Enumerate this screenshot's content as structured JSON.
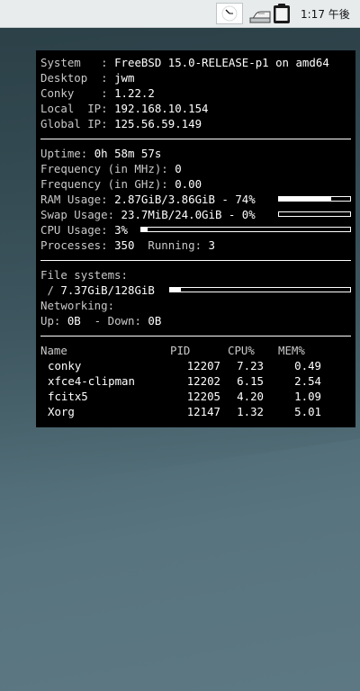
{
  "panel": {
    "clock": "1:17 午後",
    "icons": [
      "analog-clock-icon",
      "eraser-icon",
      "clipboard-icon"
    ]
  },
  "conky": {
    "system": {
      "system_label": "System   : ",
      "system_value": "FreeBSD 15.0-RELEASE-p1 on amd64",
      "desktop_label": "Desktop  : ",
      "desktop_value": "jwm",
      "conky_label": "Conky    : ",
      "conky_value": "1.22.2",
      "local_ip_label": "Local  IP: ",
      "local_ip_value": "192.168.10.154",
      "global_ip_label": "Global IP: ",
      "global_ip_value": "125.56.59.149"
    },
    "stats": {
      "uptime_label": "Uptime: ",
      "uptime_value": "0h 58m 57s",
      "freq_mhz_label": "Frequency (in MHz): ",
      "freq_mhz_value": "0",
      "freq_ghz_label": "Frequency (in GHz): ",
      "freq_ghz_value": "0.00",
      "ram_label": "RAM Usage: ",
      "ram_value": "2.87GiB/3.86GiB - 74%",
      "ram_percent": 74,
      "swap_label": "Swap Usage: ",
      "swap_value": "23.7MiB/24.0GiB - 0%",
      "swap_percent": 0,
      "cpu_label": "CPU Usage: ",
      "cpu_value": "3%",
      "cpu_percent": 3,
      "processes_label": "Processes: ",
      "processes_value": "350",
      "running_label": "  Running: ",
      "running_value": "3"
    },
    "storage": {
      "fs_heading": "File systems:",
      "root_label": " / ",
      "root_value": "7.37GiB/128GiB",
      "root_percent": 6,
      "net_heading": "Networking:",
      "up_label": "Up: ",
      "up_value": "0B",
      "down_label": "  - Down: ",
      "down_value": "0B"
    },
    "processes": {
      "headers": {
        "name": "Name",
        "pid": "PID",
        "cpu": "CPU%",
        "mem": "MEM%"
      },
      "rows": [
        {
          "name": "conky",
          "pid": "12207",
          "cpu": "7.23",
          "mem": "0.49"
        },
        {
          "name": "xfce4-clipman",
          "pid": "12202",
          "cpu": "6.15",
          "mem": "2.54"
        },
        {
          "name": "fcitx5",
          "pid": "12205",
          "cpu": "4.20",
          "mem": "1.09"
        },
        {
          "name": "Xorg",
          "pid": "12147",
          "cpu": "1.32",
          "mem": "5.01"
        }
      ]
    }
  }
}
